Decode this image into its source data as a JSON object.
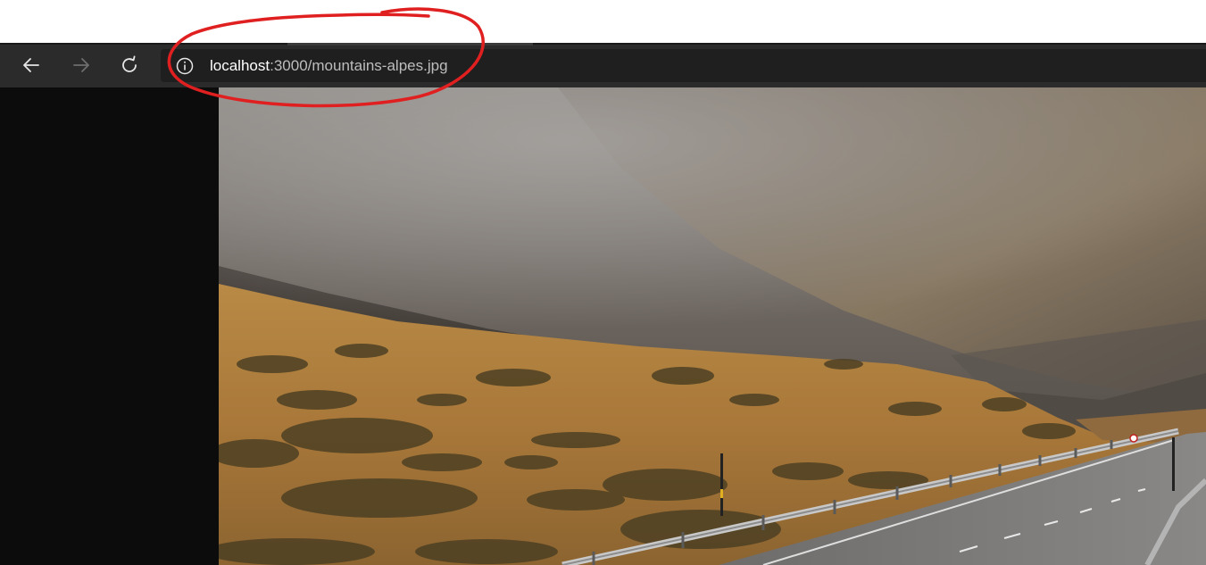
{
  "browser": {
    "url_host": "localhost",
    "url_path": ":3000/mountains-alpes.jpg",
    "back_icon": "arrow-left-icon",
    "forward_icon": "arrow-right-icon",
    "reload_icon": "refresh-icon",
    "site_info_icon": "info-circle-icon",
    "forward_enabled": false
  },
  "annotation": {
    "shape": "hand-drawn-circle",
    "color": "#e02020"
  },
  "image": {
    "subject": "mountains-alpes"
  },
  "colors": {
    "toolbar": "#2b2b2b",
    "address_bar": "#1f1f1f",
    "viewer_bg": "#0c0c0c"
  }
}
